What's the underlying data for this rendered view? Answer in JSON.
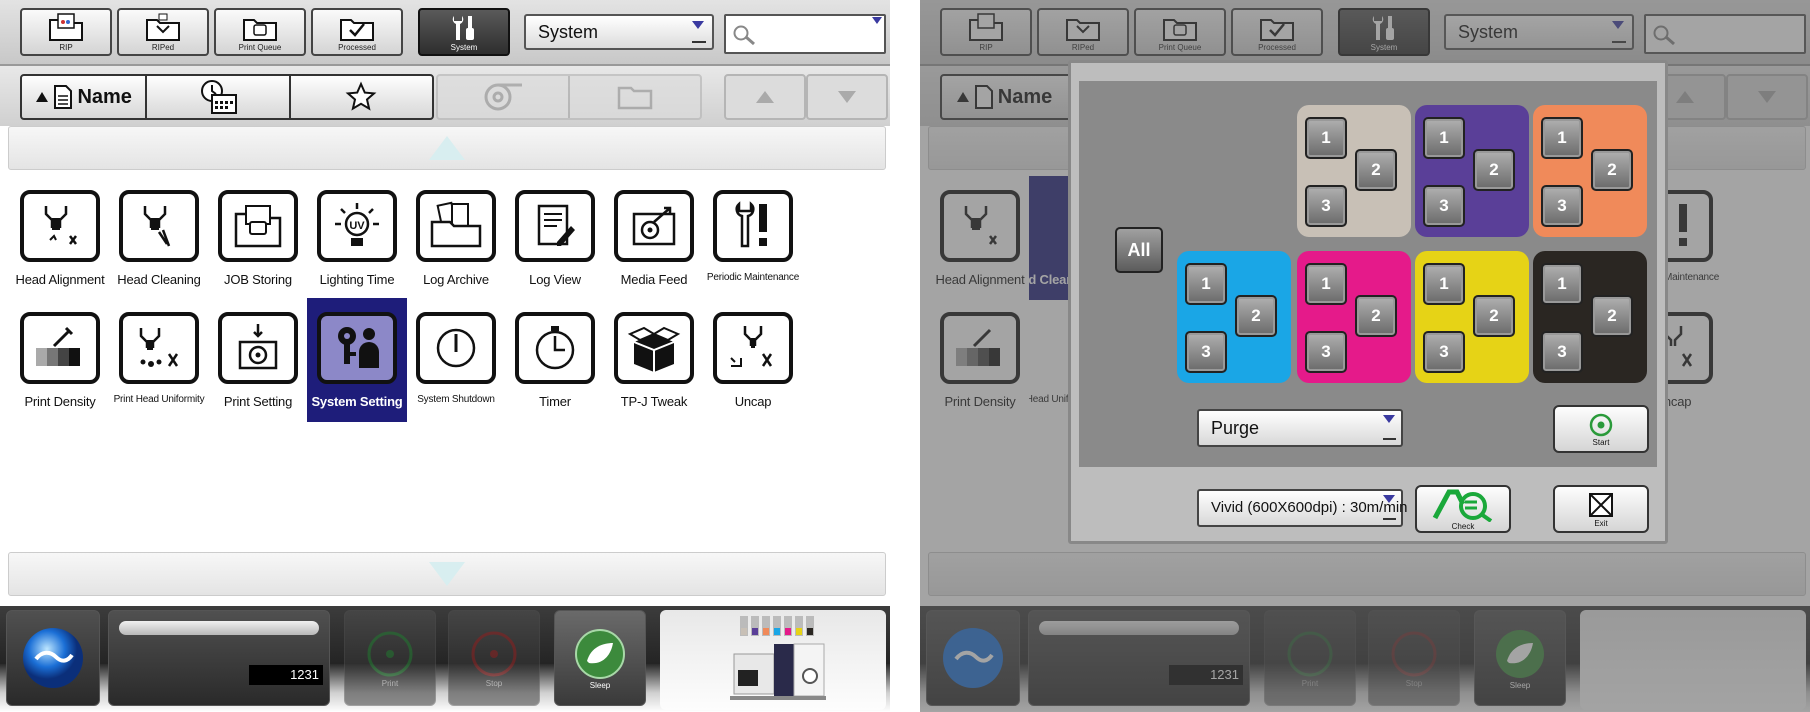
{
  "top_tabs": [
    {
      "label": "RIP",
      "icon": "rip-folder-icon"
    },
    {
      "label": "RIPed",
      "icon": "riped-folder-icon"
    },
    {
      "label": "Print Queue",
      "icon": "print-queue-folder-icon"
    },
    {
      "label": "Processed",
      "icon": "processed-folder-icon"
    },
    {
      "label": "System",
      "icon": "wrench-tools-icon"
    }
  ],
  "category_select": {
    "value": "System"
  },
  "search": {
    "placeholder": ""
  },
  "sort": {
    "name_label": "Name"
  },
  "tiles": [
    {
      "label": "Head Alignment",
      "icon": "head-alignment-icon"
    },
    {
      "label": "Head Cleaning",
      "icon": "head-cleaning-icon"
    },
    {
      "label": "JOB Storing",
      "icon": "job-storing-icon"
    },
    {
      "label": "Lighting Time",
      "icon": "uv-lamp-icon"
    },
    {
      "label": "Log Archive",
      "icon": "log-archive-icon"
    },
    {
      "label": "Log View",
      "icon": "log-view-icon"
    },
    {
      "label": "Media Feed",
      "icon": "media-feed-icon"
    },
    {
      "label": "Periodic Maintenance",
      "icon": "maintenance-icon"
    },
    {
      "label": "Print Density",
      "icon": "print-density-icon"
    },
    {
      "label": "Print Head Uniformity",
      "icon": "head-uniformity-icon"
    },
    {
      "label": "Print Setting",
      "icon": "print-setting-icon"
    },
    {
      "label": "System Setting",
      "icon": "system-setting-icon",
      "selected": true
    },
    {
      "label": "System Shutdown",
      "icon": "power-icon"
    },
    {
      "label": "Timer",
      "icon": "timer-icon"
    },
    {
      "label": "TP-J Tweak",
      "icon": "tpj-tweak-icon"
    },
    {
      "label": "Uncap",
      "icon": "uncap-icon"
    }
  ],
  "bottom": {
    "counter": "1231",
    "print_label": "Print",
    "stop_label": "Stop",
    "sleep_label": "Sleep"
  },
  "dialog": {
    "all_label": "All",
    "head_numbers": [
      "1",
      "2",
      "3"
    ],
    "color_groups": [
      {
        "name": "light-grey",
        "color": "#c8c0b6"
      },
      {
        "name": "violet",
        "color": "#5a3f98"
      },
      {
        "name": "orange",
        "color": "#f08a5a"
      },
      {
        "name": "cyan",
        "color": "#1aa6e6"
      },
      {
        "name": "magenta",
        "color": "#e51a8a"
      },
      {
        "name": "yellow",
        "color": "#e6d316"
      },
      {
        "name": "black",
        "color": "#2a2622"
      }
    ],
    "action_select": {
      "value": "Purge"
    },
    "mode_select": {
      "value": "Vivid (600X600dpi) : 30m/min"
    },
    "start_label": "Start",
    "check_label": "Check",
    "exit_label": "Exit"
  },
  "colors": {
    "selection": "#1e1d7a",
    "dropdown_arrow": "#3a3aa0"
  }
}
